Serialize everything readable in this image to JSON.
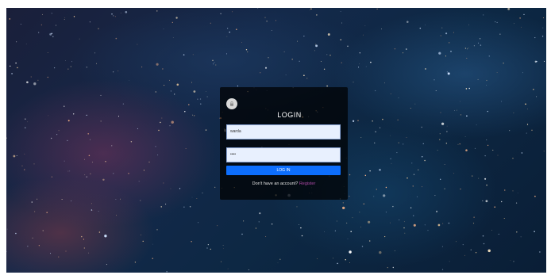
{
  "background": {
    "description_colors": [
      "#1a1f3a",
      "#14294a",
      "#0d2844",
      "#0a1e36"
    ]
  },
  "login": {
    "avatar_icon": "user-lock-icon",
    "title": "LOGIN",
    "username_value": "warda",
    "password_value": "••••",
    "button_label": "LOG IN",
    "footer_text": "Don't have an account?",
    "register_link": "Register"
  },
  "colors": {
    "accent": "#0d6efd",
    "link": "#b04aa8",
    "panel": "rgba(0,0,0,0.72)"
  }
}
